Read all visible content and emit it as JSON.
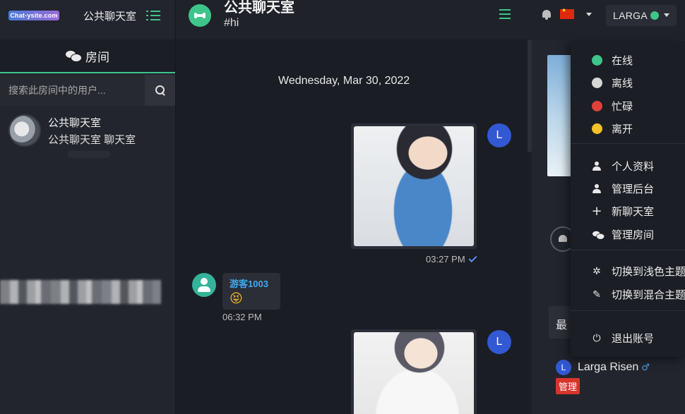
{
  "brand": {
    "logo_text": "Chat-ysite.com",
    "title": "公共聊天室"
  },
  "sidebar": {
    "tab_label": "房间",
    "search_placeholder": "搜索此房间中的用户...",
    "rooms": [
      {
        "name": "公共聊天室",
        "subtitle": "公共聊天室 聊天室"
      }
    ]
  },
  "header": {
    "room_title": "公共聊天室",
    "room_tag": "#hi",
    "user_name": "LARGA",
    "status_color": "#3fc58a",
    "language_flag": "CN"
  },
  "chat": {
    "date_separator": "Wednesday, Mar 30, 2022",
    "messages": [
      {
        "sender_initial": "L",
        "type": "image",
        "time": "03:27 PM",
        "read": true
      },
      {
        "sender": "游客1003",
        "type": "emoji",
        "emoji": "😝",
        "time": "06:32 PM"
      },
      {
        "sender_initial": "L",
        "type": "image"
      }
    ]
  },
  "right_panel": {
    "latest_label": "最",
    "member": {
      "initial": "L",
      "name": "Larga Risen",
      "gender_icon": "♂",
      "badge": "管理"
    }
  },
  "dropdown": {
    "status": [
      {
        "label": "在线",
        "color": "#3fc58a"
      },
      {
        "label": "离线",
        "color": "#d7d7d7"
      },
      {
        "label": "忙碌",
        "color": "#e0413a"
      },
      {
        "label": "离开",
        "color": "#f3c12a"
      }
    ],
    "actions": [
      {
        "label": "个人资料",
        "icon": "person-icon"
      },
      {
        "label": "管理后台",
        "icon": "user-admin-icon"
      },
      {
        "label": "新聊天室",
        "icon": "plus-icon"
      },
      {
        "label": "管理房间",
        "icon": "comments-icon"
      }
    ],
    "themes": [
      {
        "label": "切换到浅色主题",
        "icon": "sun-icon"
      },
      {
        "label": "切换到混合主题",
        "icon": "brush-icon"
      }
    ],
    "logout_label": "退出账号"
  }
}
